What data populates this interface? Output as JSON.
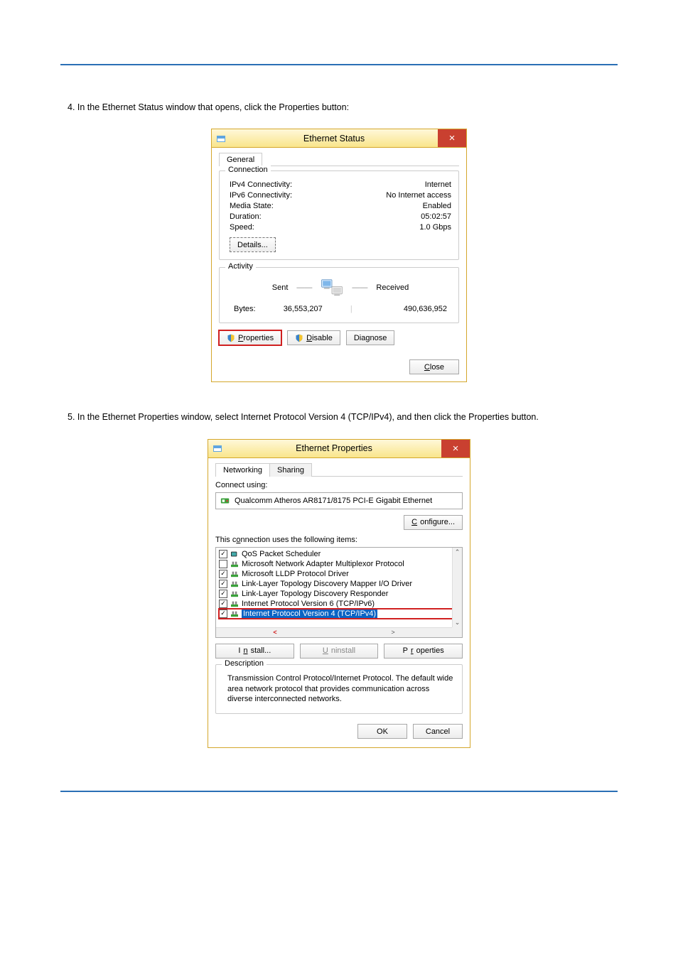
{
  "instr1": "4. In the Ethernet Status window that opens, click the Properties button:",
  "instr2": "5. In the Ethernet Properties window, select Internet Protocol Version 4 (TCP/IPv4), and then click the Properties button.",
  "status_win": {
    "title": "Ethernet Status",
    "close": "×",
    "tab_general": "General",
    "group_conn": "Connection",
    "ipv4_l": "IPv4 Connectivity:",
    "ipv4_v": "Internet",
    "ipv6_l": "IPv6 Connectivity:",
    "ipv6_v": "No Internet access",
    "media_l": "Media State:",
    "media_v": "Enabled",
    "dur_l": "Duration:",
    "dur_v": "05:02:57",
    "speed_l": "Speed:",
    "speed_v": "1.0 Gbps",
    "details_btn": "Details...",
    "group_act": "Activity",
    "sent": "Sent",
    "received": "Received",
    "bytes_l": "Bytes:",
    "bytes_sent": "36,553,207",
    "bytes_recv": "490,636,952",
    "properties_btn": "Properties",
    "disable_btn": "Disable",
    "diagnose_btn": "Diagnose",
    "close_btn": "Close"
  },
  "props_win": {
    "title": "Ethernet Properties",
    "close": "×",
    "tab_net": "Networking",
    "tab_share": "Sharing",
    "connect_using": "Connect using:",
    "adapter": "Qualcomm Atheros AR8171/8175 PCI-E Gigabit Ethernet",
    "configure_btn": "Configure...",
    "uses_items": "This connection uses the following items:",
    "items": [
      {
        "checked": true,
        "icon": "sched",
        "label": "QoS Packet Scheduler"
      },
      {
        "checked": false,
        "icon": "net",
        "label": "Microsoft Network Adapter Multiplexor Protocol"
      },
      {
        "checked": true,
        "icon": "net",
        "label": "Microsoft LLDP Protocol Driver"
      },
      {
        "checked": true,
        "icon": "net",
        "label": "Link-Layer Topology Discovery Mapper I/O Driver"
      },
      {
        "checked": true,
        "icon": "net",
        "label": "Link-Layer Topology Discovery Responder"
      },
      {
        "checked": true,
        "icon": "net",
        "label": "Internet Protocol Version 6 (TCP/IPv6)"
      },
      {
        "checked": true,
        "icon": "net",
        "label": "Internet Protocol Version 4 (TCP/IPv4)",
        "highlight": true
      }
    ],
    "install_btn": "Install...",
    "uninstall_btn": "Uninstall",
    "properties_btn": "Properties",
    "desc_label": "Description",
    "desc_text": "Transmission Control Protocol/Internet Protocol. The default wide area network protocol that provides communication across diverse interconnected networks.",
    "ok_btn": "OK",
    "cancel_btn": "Cancel"
  }
}
